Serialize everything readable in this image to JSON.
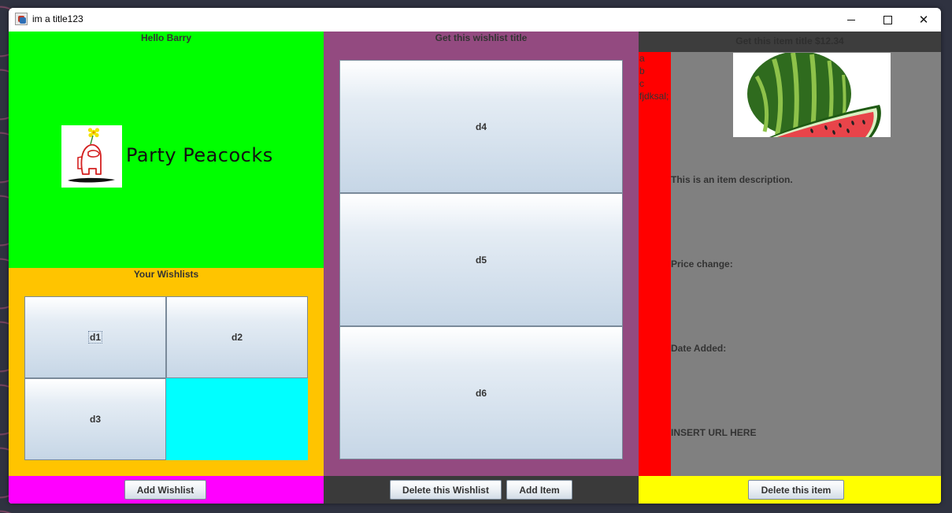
{
  "window": {
    "title": "im a title123",
    "minimize_glyph": "minimize-icon",
    "maximize_glyph": "maximize-icon",
    "close_glyph": "✕"
  },
  "left": {
    "greeting": "Hello Barry",
    "brand_name": "Party Peacocks",
    "wishlists_heading": "Your Wishlists",
    "wishlists": [
      {
        "label": "d1"
      },
      {
        "label": "d2"
      },
      {
        "label": "d3"
      }
    ],
    "add_wishlist_label": "Add Wishlist"
  },
  "middle": {
    "heading": "Get this wishlist title",
    "items": [
      {
        "label": "d4"
      },
      {
        "label": "d5"
      },
      {
        "label": "d6"
      }
    ],
    "delete_wishlist_label": "Delete this Wishlist",
    "add_item_label": "Add Item"
  },
  "right": {
    "heading": "Get this item title  $12.34",
    "side_list": [
      "a",
      "b",
      "c",
      "fjdksal;"
    ],
    "description": "This is an item description.",
    "price_change_label": "Price change:",
    "date_added_label": "Date Added:",
    "url_text": "INSERT URL HERE",
    "delete_item_label": "Delete this item"
  },
  "colors": {
    "profile_panel": "#00ff00",
    "wishlists_panel": "#ffc400",
    "add_bar": "#ff00ff",
    "wishlist_panel": "#934a80",
    "wishlist_bar": "#3a3a3a",
    "item_header": "#3d3d3d",
    "side_panel": "#ff0000",
    "item_panel": "#808080",
    "item_bar": "#ffff00",
    "empty_cell": "#00ffff"
  }
}
